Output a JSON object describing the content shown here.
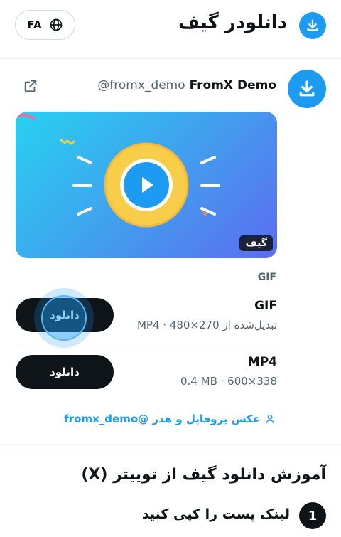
{
  "header": {
    "title": "دانلودر گیف",
    "lang_label": "FA",
    "accent_color": "#1d9bf0"
  },
  "tweet": {
    "display_name": "FromX Demo",
    "handle": "@fromx_demo",
    "media_badge": "گیف",
    "media_section_label": "GIF"
  },
  "formats": [
    {
      "title": "GIF",
      "subtitle": "تبدیل‌شده از MP4 · 480×270",
      "button_label": "دانلود"
    },
    {
      "title": "MP4",
      "subtitle": "0.4 MB · 600×338",
      "button_label": "دانلود"
    }
  ],
  "profile_link": "عکس پروفایل و هدر @fromx_demo",
  "tutorial": {
    "title": "آموزش دانلود گیف از توییتر (X)",
    "steps": [
      {
        "number": "1",
        "text": "لینک پست را کپی کنید"
      }
    ]
  },
  "icons": [
    "download-icon",
    "globe-icon",
    "external-link-icon",
    "play-icon",
    "person-icon"
  ]
}
